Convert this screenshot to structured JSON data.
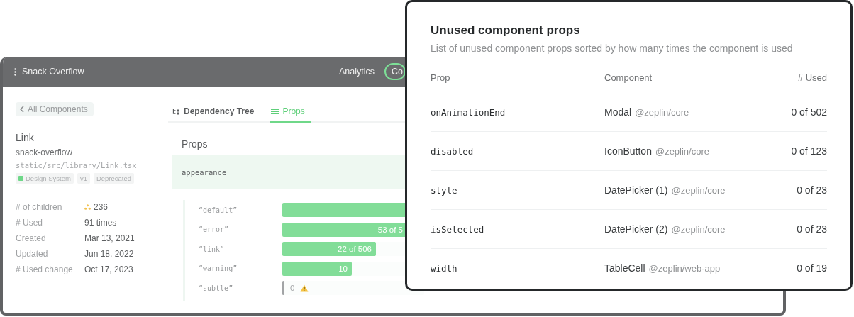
{
  "app": {
    "title": "Snack Overflow",
    "nav": [
      {
        "label": "Analytics",
        "selected": false
      },
      {
        "label": "Co",
        "selected": true
      }
    ]
  },
  "back_button": "All Components",
  "component": {
    "name": "Link",
    "package": "snack-overflow",
    "path": "static/src/library/Link.tsx",
    "tags": [
      {
        "label": "Design System",
        "color": "#6fd889"
      },
      {
        "label": "v1"
      },
      {
        "label": "Deprecated"
      }
    ]
  },
  "stats": [
    {
      "label": "# of children",
      "value": "236",
      "kind": "children"
    },
    {
      "label": "# Used",
      "value": "91 times",
      "kind": "plain"
    },
    {
      "label": "Created",
      "value": "Mar 13, 2021",
      "kind": "plain"
    },
    {
      "label": "Updated",
      "value": "Jun 18, 2022",
      "kind": "plain"
    },
    {
      "label": "# Used change",
      "value": "Oct 17, 2023",
      "kind": "plain"
    }
  ],
  "tabs": [
    {
      "label": "Dependency Tree",
      "selected": false
    },
    {
      "label": "Props",
      "selected": true
    }
  ],
  "props": {
    "title": "Props",
    "prop": "appearance",
    "values": [
      {
        "label": "“default”",
        "level": 1,
        "warning": false
      },
      {
        "label": "“error”",
        "level": 0.88,
        "value": "53 of 5",
        "warning": false
      },
      {
        "label": "“link”",
        "level": 0.66,
        "value": "22 of 506",
        "warning": false
      },
      {
        "label": "“warning”",
        "level": 0.49,
        "value": "10",
        "warning": false
      },
      {
        "label": "“subtle”",
        "level": 0,
        "value": "0",
        "warning": true
      }
    ]
  },
  "unused_props": {
    "title": "Unused component props",
    "subtitle": "List of unused component props sorted by how many times the component is used",
    "columns": [
      "Prop",
      "Component",
      "# Used"
    ],
    "rows": [
      {
        "prop": "onAnimationEnd",
        "component": "Modal",
        "package": "@zeplin/core",
        "used": "0 of 502"
      },
      {
        "prop": "disabled",
        "component": "IconButton",
        "package": "@zeplin/core",
        "used": "0 of 123"
      },
      {
        "prop": "style",
        "component": "DatePicker (1)",
        "package": "@zeplin/core",
        "used": "0 of 23"
      },
      {
        "prop": "isSelected",
        "component": "DatePicker (2)",
        "package": "@zeplin/core",
        "used": "0 of 23"
      },
      {
        "prop": "width",
        "component": "TableCell",
        "package": "@zeplin/web-app",
        "used": "0 of 19"
      }
    ]
  }
}
